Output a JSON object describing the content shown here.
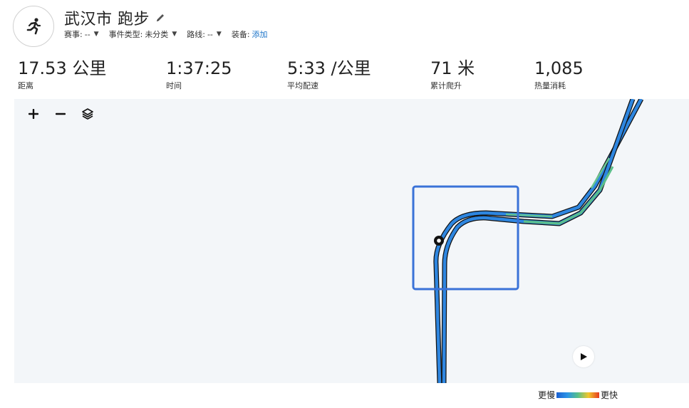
{
  "activity": {
    "title": "武汉市 跑步",
    "avatar_icon": "running-person-icon",
    "edit_icon": "pencil-icon"
  },
  "meta": {
    "race_label": "赛事:",
    "race_value": "--",
    "event_type_label": "事件类型:",
    "event_type_value": "未分类",
    "route_label": "路线:",
    "route_value": "--",
    "gear_label": "装备:",
    "gear_link": "添加"
  },
  "stats": {
    "distance_value": "17.53 公里",
    "distance_label": "距离",
    "time_value": "1:37:25",
    "time_label": "时间",
    "pace_value": "5:33 /公里",
    "pace_label": "平均配速",
    "elevation_value": "71 米",
    "elevation_label": "累计爬升",
    "calories_value": "1,085",
    "calories_label": "热量消耗"
  },
  "map": {
    "zoom_in_icon": "plus-icon",
    "zoom_out_icon": "minus-icon",
    "layers_icon": "layers-icon",
    "play_icon": "play-icon",
    "route_color": "#2e86e0",
    "selection_color": "#3a72d8"
  },
  "legend": {
    "slower": "更慢",
    "faster": "更快",
    "colors": [
      "#1a5fd1",
      "#2b93e6",
      "#57c08a",
      "#f2c62b",
      "#e53b1f"
    ]
  }
}
